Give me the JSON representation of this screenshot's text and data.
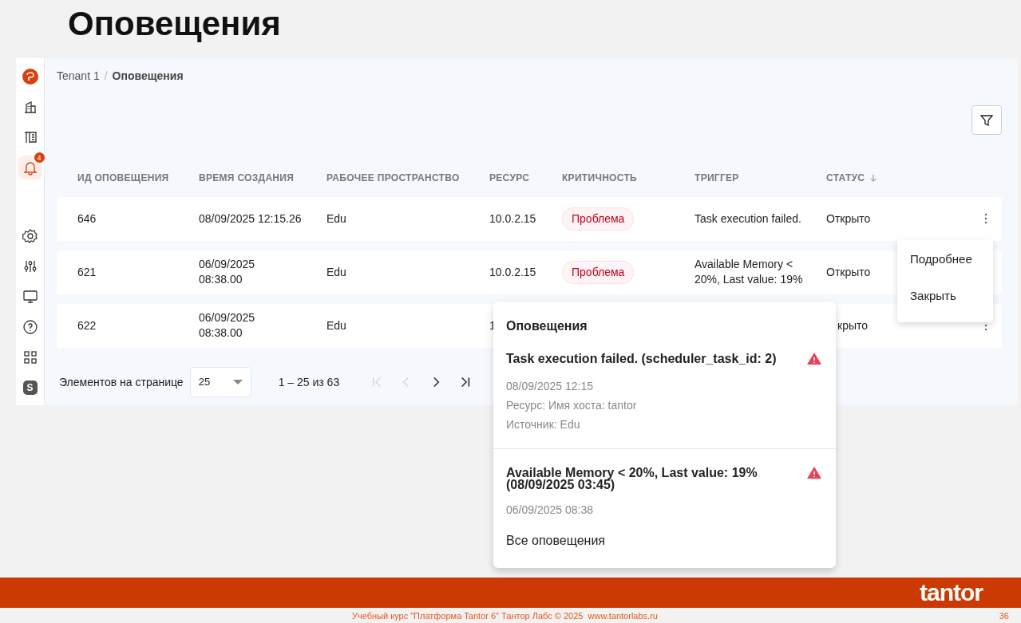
{
  "slide_title": "Оповещения",
  "sidebar": {
    "items": [
      {
        "kind": "logo",
        "selected": false
      },
      {
        "kind": "building",
        "selected": false
      },
      {
        "kind": "book",
        "selected": false
      },
      {
        "kind": "bell",
        "selected": true,
        "badge": "4"
      },
      {
        "kind": "gap"
      },
      {
        "kind": "gear",
        "selected": false
      },
      {
        "kind": "sliders",
        "selected": false
      },
      {
        "kind": "monitor",
        "selected": false
      },
      {
        "kind": "help",
        "selected": false
      },
      {
        "kind": "grid",
        "selected": false
      },
      {
        "kind": "avatar",
        "selected": false,
        "label": "S"
      }
    ]
  },
  "breadcrumb": {
    "separator": "/",
    "items": [
      "Tenant 1",
      "Оповещения"
    ]
  },
  "table": {
    "columns": [
      {
        "label": "ИД ОПОВЕЩЕНИЯ",
        "sorted": false
      },
      {
        "label": "ВРЕМЯ СОЗДАНИЯ",
        "sorted": false
      },
      {
        "label": "РАБОЧЕЕ ПРОСТРАНСТВО",
        "sorted": false
      },
      {
        "label": "РЕСУРС",
        "sorted": false
      },
      {
        "label": "КРИТИЧНОСТЬ",
        "sorted": false
      },
      {
        "label": "ТРИГГЕР",
        "sorted": false
      },
      {
        "label": "СТАТУС",
        "sorted": true
      }
    ],
    "rows": [
      {
        "id": "646",
        "created": [
          "08/09/2025 12:15.26"
        ],
        "workspace": "Edu",
        "resource": "10.0.2.15",
        "severity": "Проблема",
        "trigger": "Task execution failed.",
        "status": "Открыто",
        "covered": false
      },
      {
        "id": "621",
        "created": [
          "06/09/2025",
          "08:38.00"
        ],
        "workspace": "Edu",
        "resource": "10.0.2.15",
        "severity": "Проблема",
        "trigger": "Available Memory < 20%, Last value: 19%",
        "status": "Открыто",
        "covered": false
      },
      {
        "id": "622",
        "created": [
          "06/09/2025",
          "08:38.00"
        ],
        "workspace": "Edu",
        "resource": "1",
        "status": "крыто",
        "covered": true
      }
    ]
  },
  "pagination": {
    "label": "Элементов на странице",
    "page_size": "25",
    "range": "1 – 25 из 63",
    "buttons": [
      {
        "kind": "first",
        "disabled": true
      },
      {
        "kind": "prev",
        "disabled": true
      },
      {
        "kind": "next",
        "disabled": false
      },
      {
        "kind": "last",
        "disabled": false
      }
    ]
  },
  "row_menu": {
    "items": [
      "Подробнее",
      "Закрыть"
    ]
  },
  "notifications_popup": {
    "title": "Оповещения",
    "items": [
      {
        "title": "Task execution failed. (scheduler_task_id: 2)",
        "date": "08/09/2025 12:15",
        "details": [
          "Ресурс: Имя хоста: tantor",
          "Источник: Edu"
        ]
      },
      {
        "title": "Available Memory < 20%, Last value: 19% (08/09/2025 03:45)",
        "date": "06/09/2025 08:38"
      }
    ],
    "link": "Все оповещения"
  },
  "footer": {
    "logo": "tantor",
    "text": "Учебный курс \"Платформа Tantor 6\" Тантор Лабс © 2025  www.tantorlabs.ru",
    "page": "36"
  }
}
